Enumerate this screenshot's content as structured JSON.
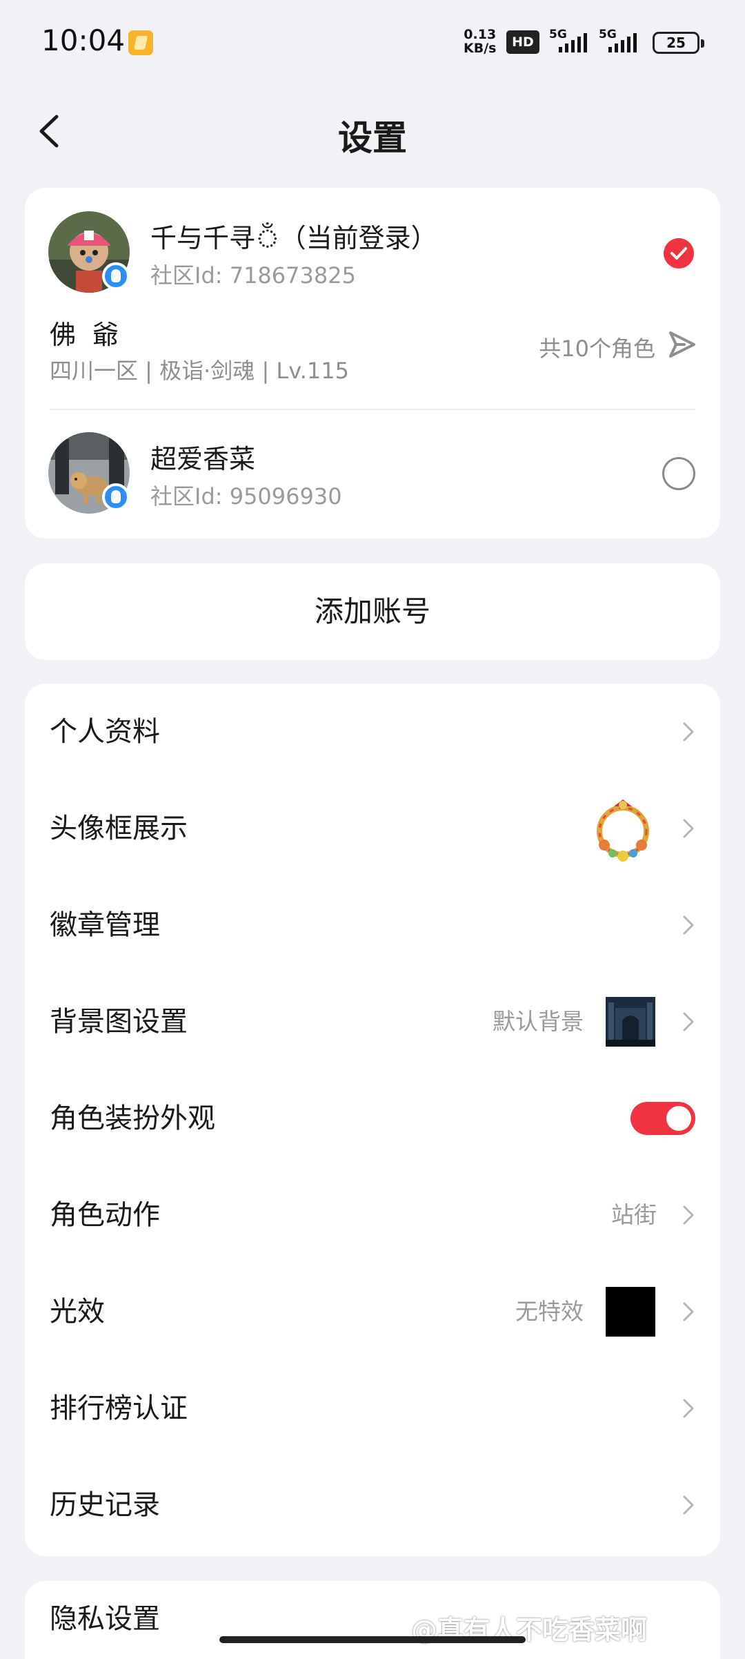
{
  "status_bar": {
    "time": "10:04",
    "net_speed_value": "0.13",
    "net_speed_unit": "KB/s",
    "hd_label": "HD",
    "sim1_label": "5G",
    "sim2_label": "5G",
    "battery": "25"
  },
  "header": {
    "title": "设置"
  },
  "accounts": {
    "current": {
      "name": "千与千寻ঁ（当前登录）",
      "community_id": "社区Id: 718673825",
      "selected": true
    },
    "role": {
      "name": "佛爺",
      "server": "四川一区 | 极诣·剑魂 | Lv.115",
      "count": "共10个角色"
    },
    "other": {
      "name": "超爱香菜",
      "community_id": "社区Id: 95096930",
      "selected": false
    }
  },
  "add_account": {
    "label": "添加账号"
  },
  "settings": {
    "items": [
      {
        "label": "个人资料",
        "value": ""
      },
      {
        "label": "头像框展示",
        "value": ""
      },
      {
        "label": "徽章管理",
        "value": ""
      },
      {
        "label": "背景图设置",
        "value": "默认背景"
      },
      {
        "label": "角色装扮外观",
        "value": "",
        "toggle_on": true
      },
      {
        "label": "角色动作",
        "value": "站街"
      },
      {
        "label": "光效",
        "value": "无特效"
      },
      {
        "label": "排行榜认证",
        "value": ""
      },
      {
        "label": "历史记录",
        "value": ""
      }
    ]
  },
  "privacy": {
    "label": "隐私设置"
  },
  "watermark": "@真有人不吃香菜啊",
  "colors": {
    "accent": "#ef3340",
    "background": "#f2f2f6",
    "card": "#ffffff",
    "secondary_text": "#9a9a9a"
  }
}
